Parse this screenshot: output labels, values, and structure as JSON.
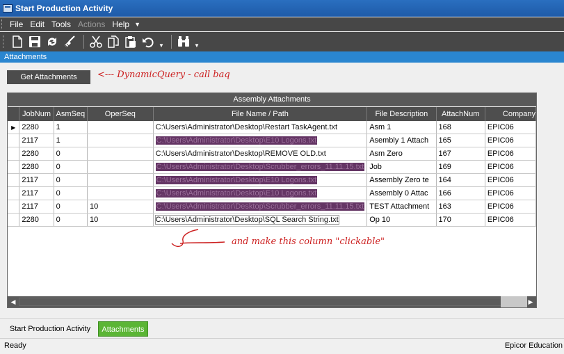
{
  "window": {
    "title": "Start Production Activity"
  },
  "menu": {
    "items": [
      {
        "label": "File",
        "enabled": true
      },
      {
        "label": "Edit",
        "enabled": true
      },
      {
        "label": "Tools",
        "enabled": true
      },
      {
        "label": "Actions",
        "enabled": false
      },
      {
        "label": "Help",
        "enabled": true
      }
    ]
  },
  "toolbar": {
    "icons": [
      "new-icon",
      "save-icon",
      "refresh-icon",
      "clear-icon",
      "cut-icon",
      "copy-icon",
      "paste-icon",
      "undo-icon",
      "search-icon"
    ]
  },
  "section": {
    "title": "Attachments"
  },
  "get_button": {
    "label": "Get Attachments"
  },
  "annotations": {
    "top": "<--- DynamicQuery - call baq",
    "bottom": "and make this column \"clickable\""
  },
  "grid": {
    "caption": "Assembly Attachments",
    "columns": [
      "JobNum",
      "AsmSeq",
      "OperSeq",
      "File Name / Path",
      "File Description",
      "AttachNum",
      "Company"
    ],
    "rows": [
      {
        "job": "2280",
        "asm": "1",
        "oper": "",
        "file": "C:\\Users\\Administrator\\Desktop\\Restart TaskAgent.txt",
        "desc": "Asm 1",
        "attach": "168",
        "company": "EPIC06",
        "file_style": "plain"
      },
      {
        "job": "2117",
        "asm": "1",
        "oper": "",
        "file": "C:\\Users\\Administrator\\Desktop\\E10 Logons.txt",
        "desc": "Asembly 1 Attach",
        "attach": "165",
        "company": "EPIC06",
        "file_style": "link"
      },
      {
        "job": "2280",
        "asm": "0",
        "oper": "",
        "file": "C:\\Users\\Administrator\\Desktop\\REMOVE OLD.txt",
        "desc": "Asm Zero",
        "attach": "167",
        "company": "EPIC06",
        "file_style": "plain"
      },
      {
        "job": "2280",
        "asm": "0",
        "oper": "",
        "file": "C:\\Users\\Administrator\\Desktop\\Scrubber_errors_11.11.15.txt",
        "desc": "Job",
        "attach": "169",
        "company": "EPIC06",
        "file_style": "link"
      },
      {
        "job": "2117",
        "asm": "0",
        "oper": "",
        "file": "C:\\Users\\Administrator\\Desktop\\E10 Logons.txt",
        "desc": "Assembly Zero te",
        "attach": "164",
        "company": "EPIC06",
        "file_style": "link"
      },
      {
        "job": "2117",
        "asm": "0",
        "oper": "",
        "file": "C:\\Users\\Administrator\\Desktop\\E10 Logons.txt",
        "desc": "Assembly 0 Attac",
        "attach": "166",
        "company": "EPIC06",
        "file_style": "link"
      },
      {
        "job": "2117",
        "asm": "0",
        "oper": "10",
        "file": "C:\\Users\\Administrator\\Desktop\\Scrubber_errors_11.11.15.txt",
        "desc": "TEST Attachment",
        "attach": "163",
        "company": "EPIC06",
        "file_style": "link"
      },
      {
        "job": "2280",
        "asm": "0",
        "oper": "10",
        "file": "C:\\Users\\Administrator\\Desktop\\SQL Search String.txt",
        "desc": "Op 10",
        "attach": "170",
        "company": "EPIC06",
        "file_style": "outlined"
      }
    ]
  },
  "tabs": [
    {
      "label": "Start Production Activity",
      "active": false
    },
    {
      "label": "Attachments",
      "active": true
    }
  ],
  "status": {
    "left": "Ready",
    "right": "Epicor Education"
  }
}
